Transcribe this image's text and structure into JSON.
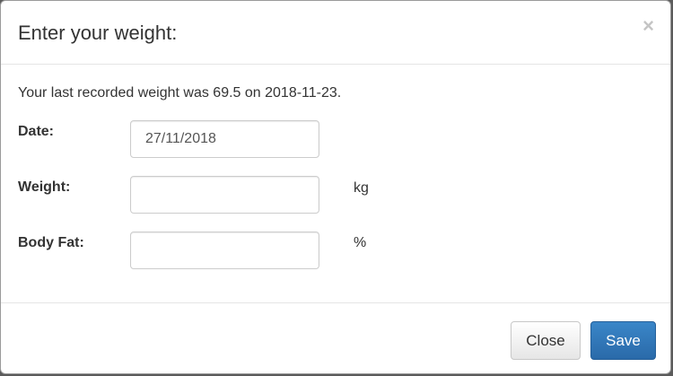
{
  "dialog": {
    "title": "Enter your weight:",
    "close_glyph": "×",
    "info_text": "Your last recorded weight was 69.5 on 2018-11-23."
  },
  "fields": {
    "date": {
      "label": "Date:",
      "value": "27/11/2018"
    },
    "weight": {
      "label": "Weight:",
      "value": "",
      "unit": "kg"
    },
    "body_fat": {
      "label": "Body Fat:",
      "value": "",
      "unit": "%"
    }
  },
  "footer": {
    "close_label": "Close",
    "save_label": "Save"
  },
  "colors": {
    "primary": "#337ab7",
    "border": "#cccccc",
    "text": "#333333"
  }
}
